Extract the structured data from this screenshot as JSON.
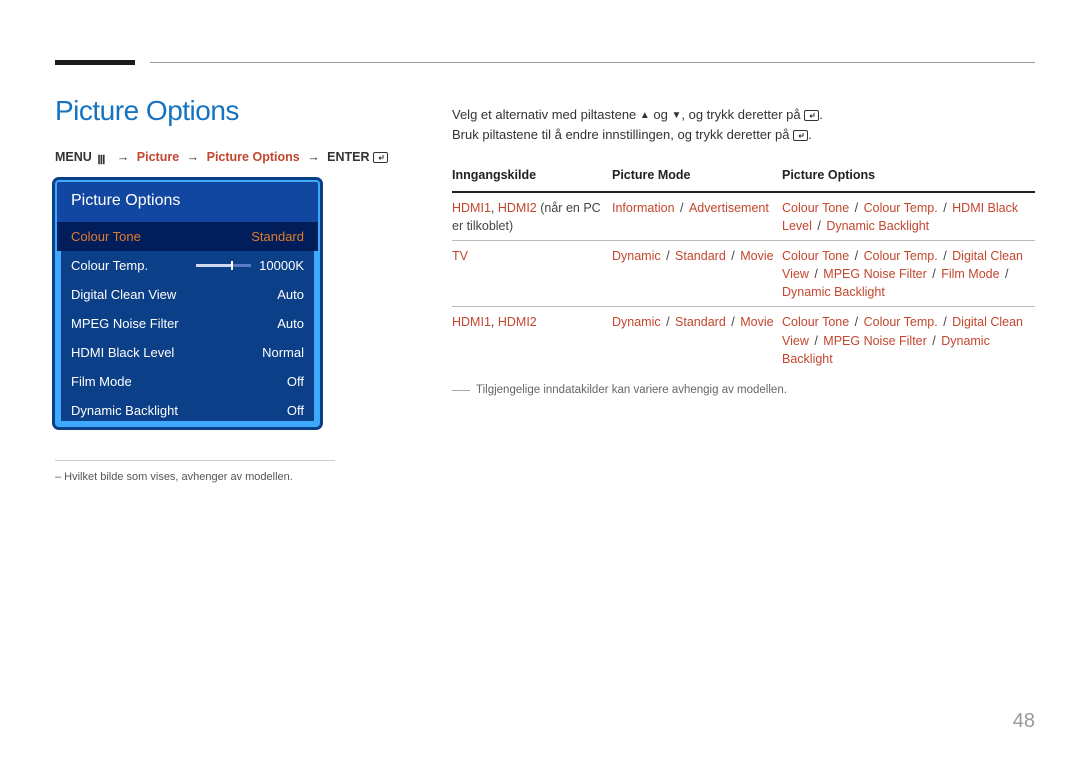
{
  "page": {
    "title": "Picture Options",
    "number": "48"
  },
  "breadcrumb": {
    "menu": "MENU",
    "picture": "Picture",
    "picture_options": "Picture Options",
    "enter": "ENTER"
  },
  "osd": {
    "title": "Picture Options",
    "rows": [
      {
        "label": "Colour Tone",
        "value": "Standard",
        "selected": true
      },
      {
        "label": "Colour Temp.",
        "value": "10000K",
        "slider": true
      },
      {
        "label": "Digital Clean View",
        "value": "Auto"
      },
      {
        "label": "MPEG Noise Filter",
        "value": "Auto"
      },
      {
        "label": "HDMI Black Level",
        "value": "Normal"
      },
      {
        "label": "Film Mode",
        "value": "Off"
      },
      {
        "label": "Dynamic Backlight",
        "value": "Off"
      }
    ],
    "footnote": "– Hvilket bilde som vises, avhenger av modellen."
  },
  "instructions": {
    "line1_a": "Velg et alternativ med piltastene ",
    "line1_b": " og ",
    "line1_c": ", og trykk deretter på ",
    "line1_d": ".",
    "line2_a": "Bruk piltastene til å endre innstillingen, og trykk deretter på ",
    "line2_b": "."
  },
  "table": {
    "headers": {
      "c1": "Inngangskilde",
      "c2": "Picture Mode",
      "c3": "Picture Options"
    },
    "rows": [
      {
        "c1_parts": [
          "HDMI1",
          ", ",
          "HDMI2"
        ],
        "c1_suffix": " (når en PC er tilkoblet)",
        "c2_parts": [
          "Information",
          " / ",
          "Advertisement"
        ],
        "c3_parts": [
          "Colour Tone",
          " / ",
          "Colour Temp.",
          " / ",
          "HDMI Black Level",
          " / ",
          "Dynamic Backlight"
        ]
      },
      {
        "c1_parts": [
          "TV"
        ],
        "c1_suffix": "",
        "c2_parts": [
          "Dynamic",
          " / ",
          "Standard",
          " / ",
          "Movie"
        ],
        "c3_parts": [
          "Colour Tone",
          " / ",
          "Colour Temp.",
          " / ",
          "Digital Clean View",
          " / ",
          "MPEG Noise Filter",
          " / ",
          "Film Mode",
          " / ",
          "Dynamic Backlight"
        ]
      },
      {
        "c1_parts": [
          "HDMI1",
          ", ",
          "HDMI2"
        ],
        "c1_suffix": "",
        "c2_parts": [
          "Dynamic",
          " / ",
          "Standard",
          " / ",
          "Movie"
        ],
        "c3_parts": [
          "Colour Tone",
          " / ",
          "Colour Temp.",
          " / ",
          "Digital Clean View",
          " / ",
          "MPEG Noise Filter",
          " / ",
          "Dynamic Backlight"
        ]
      }
    ],
    "footnote": "Tilgjengelige inndatakilder kan variere avhengig av modellen."
  }
}
